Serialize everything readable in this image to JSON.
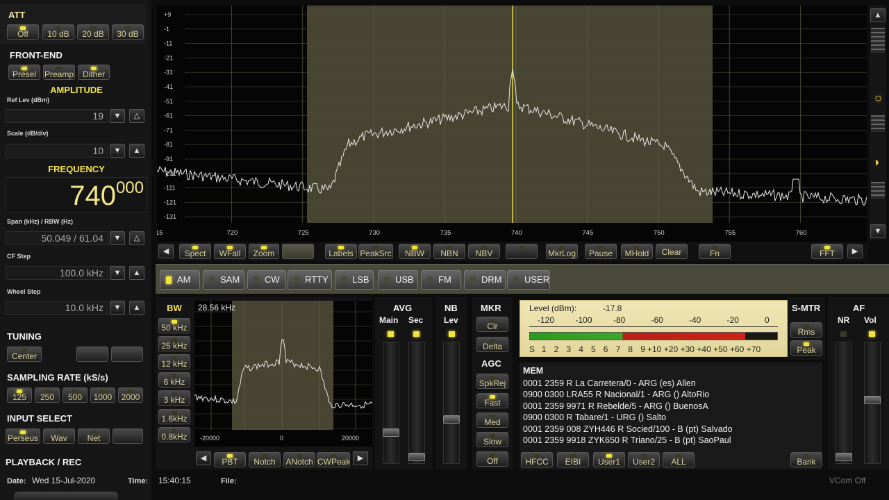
{
  "left": {
    "att": {
      "title": "ATT",
      "buttons": [
        "Off",
        "10 dB",
        "20 dB",
        "30 dB"
      ]
    },
    "frontend": {
      "title": "FRONT-END",
      "buttons": [
        "Presel",
        "Preamp",
        "Dither"
      ]
    },
    "amplitude": {
      "title": "AMPLITUDE",
      "ref_label": "Ref Lev (dBm)",
      "ref_value": "19",
      "scale_label": "Scale (dB/div)",
      "scale_value": "10"
    },
    "frequency": {
      "title": "FREQUENCY",
      "main": "740",
      "sub": "000"
    },
    "span_label": "Span (kHz) / RBW (Hz)",
    "span_value": "50.049 / 61.04",
    "cf_label": "CF Step",
    "cf_value": "100.0 kHz",
    "wheel_label": "Wheel Step",
    "wheel_value": "10.0 kHz",
    "tuning": {
      "title": "TUNING",
      "center": "Center"
    },
    "sampling": {
      "title": "SAMPLING RATE (kS/s)",
      "rates": [
        "125",
        "250",
        "500",
        "1000",
        "2000"
      ]
    },
    "input": {
      "title": "INPUT SELECT",
      "buttons": [
        "Perseus",
        "Wav",
        "Net"
      ]
    },
    "playback": "PLAYBACK / REC",
    "date_label": "Date:",
    "date": "Wed 15-Jul-2020",
    "time_label": "Time:",
    "time": "15:40:15",
    "file_label": "File:"
  },
  "spectrum": {
    "db_ticks": [
      "+9",
      "-1",
      "-11",
      "-21",
      "-31",
      "-41",
      "-51",
      "-61",
      "-71",
      "-81",
      "-91",
      "-101",
      "-111",
      "-121",
      "-131"
    ],
    "freq_ticks": [
      "15",
      "720",
      "725",
      "730",
      "735",
      "740",
      "745",
      "750",
      "755",
      "760",
      "76"
    ],
    "toolbar": [
      "Spect",
      "WFall",
      "Zoom",
      "Labels",
      "PeakSrc",
      "NBW",
      "NBN",
      "NBV",
      "MkrLog",
      "Pause",
      "MHold",
      "Clear",
      "Fn",
      "FFT"
    ]
  },
  "modes": [
    "AM",
    "SAM",
    "CW",
    "RTTY",
    "LSB",
    "USB",
    "FM",
    "DRM",
    "USER"
  ],
  "bw": {
    "title": "BW",
    "buttons": [
      "50 kHz",
      "25 kHz",
      "12 kHz",
      "6 kHz",
      "3 kHz",
      "1.6kHz",
      "0.8kHz"
    ],
    "readout": "28.56 kHz",
    "ticks": [
      "-20000",
      "0",
      "20000"
    ],
    "toolbar": [
      "PBT",
      "Notch",
      "ANotch",
      "CWPeak"
    ]
  },
  "avg": {
    "title": "AVG",
    "main": "Main",
    "sec": "Sec"
  },
  "nb": {
    "title": "NB",
    "lev": "Lev"
  },
  "mkr": {
    "title": "MKR",
    "buttons": [
      "Clr",
      "Delta"
    ]
  },
  "agc": {
    "title": "AGC",
    "buttons": [
      "SpkRej",
      "Fast",
      "Med",
      "Slow",
      "Off"
    ]
  },
  "level": {
    "label": "Level (dBm):",
    "value": "-17.8",
    "top_scale": [
      "-120",
      "-100",
      "-80",
      "-60",
      "-40",
      "-20",
      "0"
    ],
    "bottom_scale": [
      "S",
      "1",
      "2",
      "3",
      "4",
      "5",
      "6",
      "7",
      "8",
      "9",
      "+10",
      "+20",
      "+30",
      "+40",
      "+50",
      "+60",
      "+70"
    ],
    "level_fraction": 0.87
  },
  "smtr": {
    "title": "S-MTR",
    "buttons": [
      "Rms",
      "Peak"
    ]
  },
  "af": {
    "title": "AF",
    "nr": "NR",
    "vol": "Vol"
  },
  "mem": {
    "title": "MEM",
    "rows": [
      "0001 2359 R La Carretera/0 - ARG (es) Allen",
      "0900 0300 LRA55 R Nacional/1 - ARG () AltoRio",
      "0001 2359 9971 R Rebelde/5 - ARG () BuenosA",
      "0900 0300 R Tabare/1 - URG () Salto",
      "0001 2359 008 ZYH446 R Socied/100 - B (pt) Salvado",
      "0001 2359 9918 ZYK650 R Triano/25 - B (pt) SaoPaul"
    ],
    "buttons": [
      "HFCC",
      "EIBI",
      "User1",
      "User2",
      "ALL",
      "Bank"
    ]
  },
  "status": "VCom Off"
}
